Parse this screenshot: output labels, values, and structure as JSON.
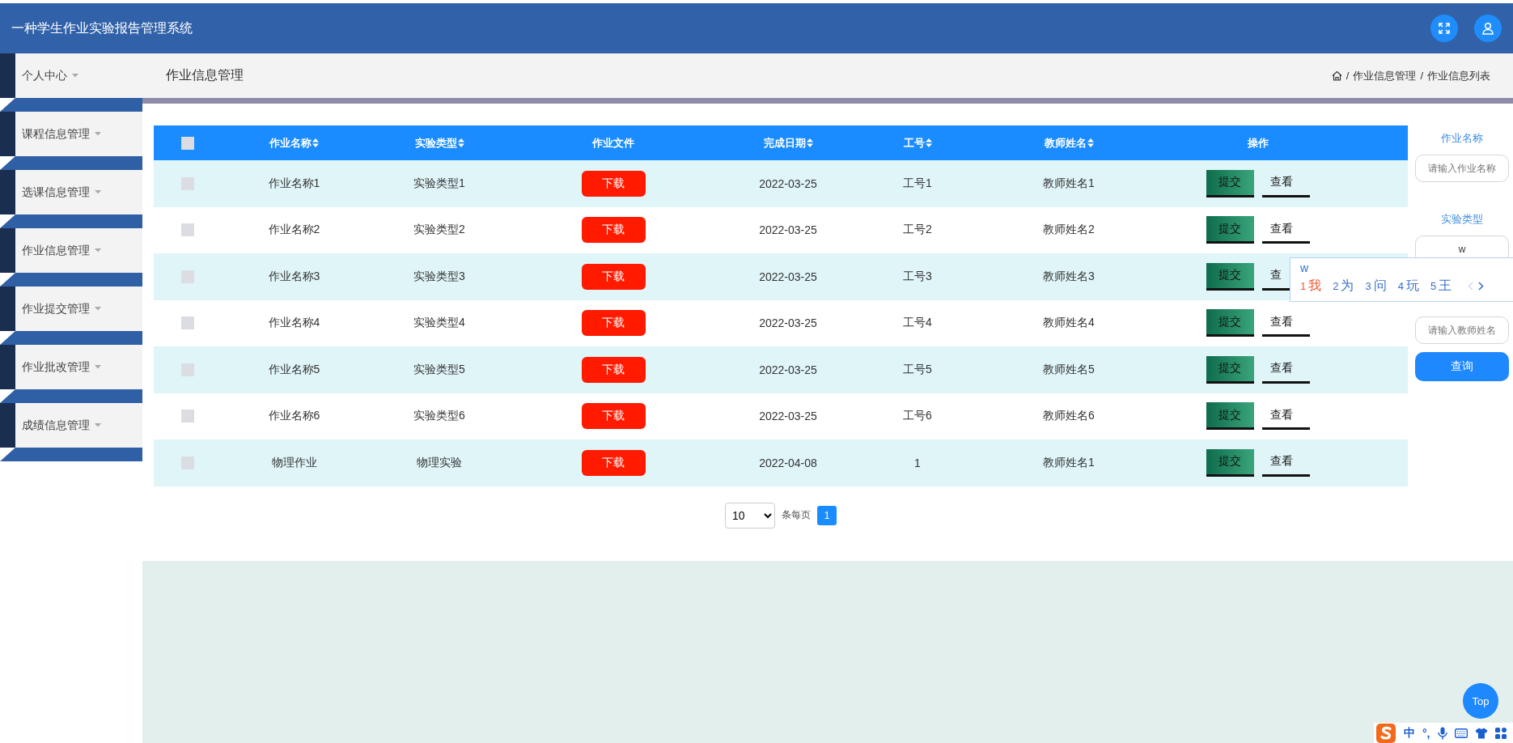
{
  "header": {
    "title": "一种学生作业实验报告管理系统"
  },
  "sidebar": {
    "items": [
      {
        "label": "个人中心"
      },
      {
        "label": "课程信息管理"
      },
      {
        "label": "选课信息管理"
      },
      {
        "label": "作业信息管理"
      },
      {
        "label": "作业提交管理"
      },
      {
        "label": "作业批改管理"
      },
      {
        "label": "成绩信息管理"
      }
    ]
  },
  "page_header": {
    "title": "作业信息管理",
    "breadcrumb": [
      {
        "separator": "/",
        "label": "作业信息管理"
      },
      {
        "separator": "/",
        "label": "作业信息列表"
      }
    ]
  },
  "table": {
    "select_all": {
      "checked": false
    },
    "columns": [
      {
        "label": "作业名称",
        "sortable": true
      },
      {
        "label": "实验类型",
        "sortable": true
      },
      {
        "label": "作业文件",
        "sortable": false
      },
      {
        "label": "完成日期",
        "sortable": true
      },
      {
        "label": "工号",
        "sortable": true
      },
      {
        "label": "教师姓名",
        "sortable": true
      },
      {
        "label": "操作",
        "sortable": false
      }
    ],
    "rows": [
      {
        "checked": false,
        "name": "作业名称1",
        "type": "实验类型1",
        "file": "下载",
        "date": "2022-03-25",
        "staff_no": "工号1",
        "teacher": "教师姓名1",
        "actions": [
          {
            "kind": "submit",
            "label": "提交"
          },
          {
            "kind": "view",
            "label": "查看"
          }
        ]
      },
      {
        "checked": false,
        "name": "作业名称2",
        "type": "实验类型2",
        "file": "下载",
        "date": "2022-03-25",
        "staff_no": "工号2",
        "teacher": "教师姓名2",
        "actions": [
          {
            "kind": "submit",
            "label": "提交"
          },
          {
            "kind": "view",
            "label": "查看"
          }
        ]
      },
      {
        "checked": false,
        "name": "作业名称3",
        "type": "实验类型3",
        "file": "下载",
        "date": "2022-03-25",
        "staff_no": "工号3",
        "teacher": "教师姓名3",
        "actions": [
          {
            "kind": "submit",
            "label": "提交"
          },
          {
            "kind": "view",
            "label": "查"
          }
        ]
      },
      {
        "checked": false,
        "name": "作业名称4",
        "type": "实验类型4",
        "file": "下载",
        "date": "2022-03-25",
        "staff_no": "工号4",
        "teacher": "教师姓名4",
        "actions": [
          {
            "kind": "submit",
            "label": "提交"
          },
          {
            "kind": "view",
            "label": "查看"
          }
        ]
      },
      {
        "checked": false,
        "name": "作业名称5",
        "type": "实验类型5",
        "file": "下载",
        "date": "2022-03-25",
        "staff_no": "工号5",
        "teacher": "教师姓名5",
        "actions": [
          {
            "kind": "submit",
            "label": "提交"
          },
          {
            "kind": "view",
            "label": "查看"
          }
        ]
      },
      {
        "checked": false,
        "name": "作业名称6",
        "type": "实验类型6",
        "file": "下载",
        "date": "2022-03-25",
        "staff_no": "工号6",
        "teacher": "教师姓名6",
        "actions": [
          {
            "kind": "submit",
            "label": "提交"
          },
          {
            "kind": "view",
            "label": "查看"
          }
        ]
      },
      {
        "checked": false,
        "name": "物理作业",
        "type": "物理实验",
        "file": "下载",
        "date": "2022-04-08",
        "staff_no": "1",
        "teacher": "教师姓名1",
        "actions": [
          {
            "kind": "submit",
            "label": "提交"
          },
          {
            "kind": "view",
            "label": "查看"
          }
        ]
      }
    ]
  },
  "pagination": {
    "page_size": "10",
    "per_page_label": "条每页",
    "pages": [
      {
        "label": "1",
        "selected": true
      }
    ]
  },
  "search": {
    "fields": [
      {
        "label": "作业名称",
        "placeholder": "请输入作业名称"
      },
      {
        "label": "实验类型",
        "value": "w"
      },
      {
        "placeholder": "请输入教师姓名"
      }
    ],
    "button": "查询"
  },
  "top_button": "Top",
  "ime": {
    "composition": "w",
    "candidates": [
      {
        "index": "1",
        "text": "我",
        "selected": true
      },
      {
        "index": "2",
        "text": "为",
        "selected": false
      },
      {
        "index": "3",
        "text": "问",
        "selected": false
      },
      {
        "index": "4",
        "text": "玩",
        "selected": false
      },
      {
        "index": "5",
        "text": "王",
        "selected": false
      }
    ],
    "prev_disabled": true,
    "next_disabled": false
  },
  "ime_toolbar": {
    "mode": "中",
    "punctuation": "°,"
  }
}
